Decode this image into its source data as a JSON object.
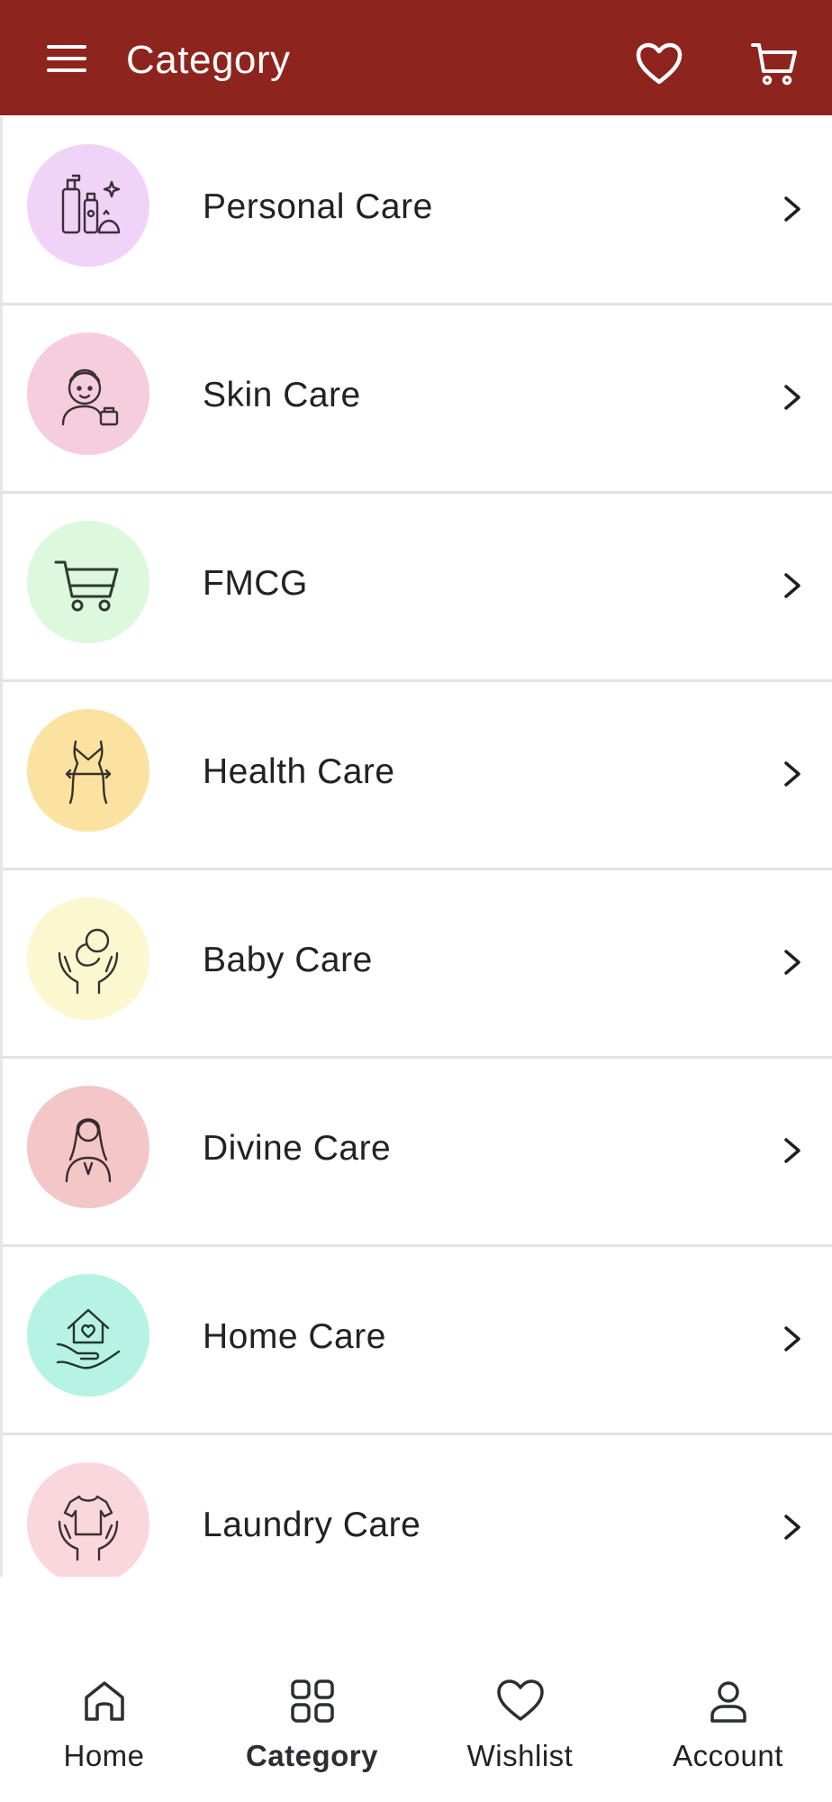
{
  "appbar": {
    "title": "Category",
    "menu_icon": "hamburger-menu-icon",
    "wishlist_icon": "heart-icon",
    "cart_icon": "cart-icon",
    "background": "#8e241e"
  },
  "categories": [
    {
      "label": "Personal Care",
      "icon": "personal-care-icon",
      "bg": "#f1d3f7"
    },
    {
      "label": "Skin Care",
      "icon": "skin-care-icon",
      "bg": "#f6cddd"
    },
    {
      "label": "FMCG",
      "icon": "shopping-cart-icon",
      "bg": "#dcf8dd"
    },
    {
      "label": "Health Care",
      "icon": "health-care-icon",
      "bg": "#fbe2a0"
    },
    {
      "label": "Baby Care",
      "icon": "baby-care-icon",
      "bg": "#fbf7cf"
    },
    {
      "label": "Divine Care",
      "icon": "divine-care-icon",
      "bg": "#f3c6c8"
    },
    {
      "label": "Home Care",
      "icon": "home-care-icon",
      "bg": "#b7f3e4"
    },
    {
      "label": "Laundry Care",
      "icon": "laundry-care-icon",
      "bg": "#f9d7dd"
    }
  ],
  "bottom_nav": [
    {
      "label": "Home",
      "icon": "home-icon",
      "active": false
    },
    {
      "label": "Category",
      "icon": "grid-icon",
      "active": true
    },
    {
      "label": "Wishlist",
      "icon": "heart-icon",
      "active": false
    },
    {
      "label": "Account",
      "icon": "user-icon",
      "active": false
    }
  ]
}
